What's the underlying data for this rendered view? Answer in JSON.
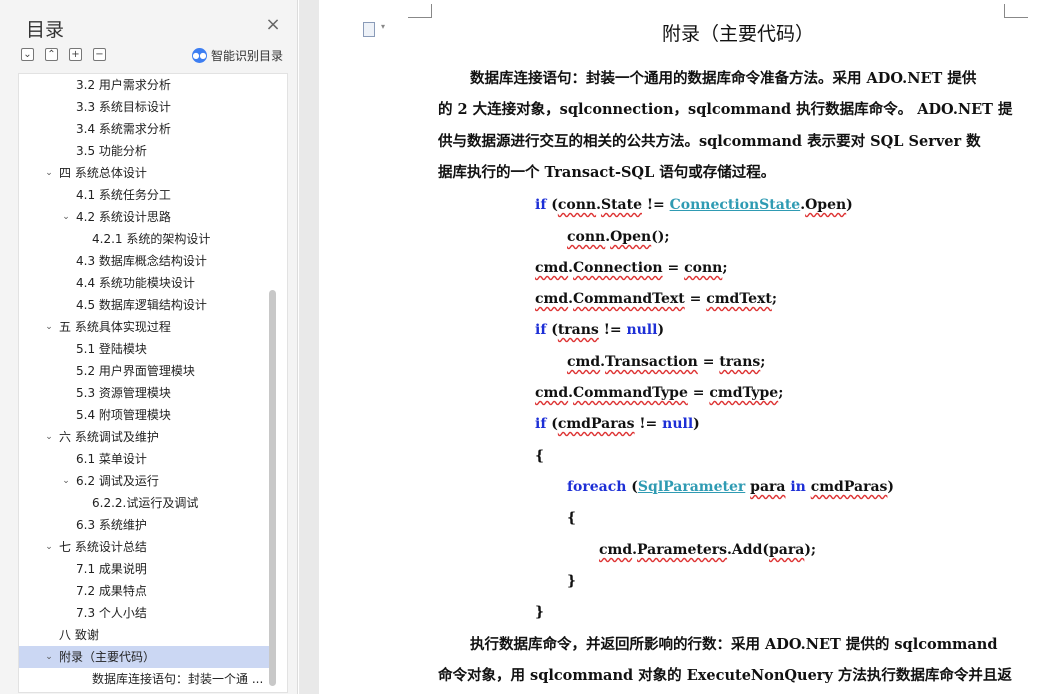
{
  "nav": {
    "title": "目录",
    "close_glyph": "×",
    "toolbar": {
      "collapse_all": "⌄",
      "expand_level": "⌃",
      "add_heading": "+",
      "remove_heading": "−"
    },
    "smart_toc_label": "智能识别目录",
    "items": [
      {
        "label": "3.2 用户需求分析",
        "level": 2
      },
      {
        "label": "3.3 系统目标设计",
        "level": 2
      },
      {
        "label": "3.4 系统需求分析",
        "level": 2
      },
      {
        "label": "3.5 功能分析",
        "level": 2
      },
      {
        "label": "四 系统总体设计",
        "level": 1,
        "expanded": true
      },
      {
        "label": "4.1 系统任务分工",
        "level": 2
      },
      {
        "label": "4.2 系统设计思路",
        "level": 2,
        "expanded": true
      },
      {
        "label": "4.2.1 系统的架构设计",
        "level": 3
      },
      {
        "label": "4.3 数据库概念结构设计",
        "level": 2
      },
      {
        "label": "4.4 系统功能模块设计",
        "level": 2
      },
      {
        "label": "4.5 数据库逻辑结构设计",
        "level": 2
      },
      {
        "label": "五 系统具体实现过程",
        "level": 1,
        "expanded": true
      },
      {
        "label": "5.1 登陆模块",
        "level": 2
      },
      {
        "label": "5.2 用户界面管理模块",
        "level": 2
      },
      {
        "label": "5.3 资源管理模块",
        "level": 2
      },
      {
        "label": "5.4 附项管理模块",
        "level": 2
      },
      {
        "label": "六 系统调试及维护",
        "level": 1,
        "expanded": true
      },
      {
        "label": "6.1 菜单设计",
        "level": 2
      },
      {
        "label": "6.2 调试及运行",
        "level": 2,
        "expanded": true
      },
      {
        "label": "6.2.2.试运行及调试",
        "level": 3
      },
      {
        "label": "6.3 系统维护",
        "level": 2
      },
      {
        "label": "七 系统设计总结",
        "level": 1,
        "expanded": true
      },
      {
        "label": "7.1 成果说明",
        "level": 2
      },
      {
        "label": "7.2 成果特点",
        "level": 2
      },
      {
        "label": "7.3 个人小结",
        "level": 2
      },
      {
        "label": "八 致谢",
        "level": 1
      },
      {
        "label": "附录（主要代码）",
        "level": 1,
        "expanded": true,
        "selected": true
      },
      {
        "label": "数据库连接语句：封装一个通 ...",
        "level": 3
      }
    ]
  },
  "document": {
    "heading": "附录（主要代码）",
    "intro_lines": [
      "数据库连接语句：封装一个通用的数据库命令准备方法。采用 ADO.NET 提供",
      "的 2 大连接对象，sqlconnection，sqlcommand 执行数据库命令。 ADO.NET 提",
      "供与数据源进行交互的相关的公共方法。sqlcommand 表示要对 SQL Server 数",
      "据库执行的一个 Transact-SQL 语句或存储过程。"
    ],
    "code_lines": [
      "if (conn.State != ConnectionState.Open)",
      "conn.Open();",
      "cmd.Connection = conn;",
      "cmd.CommandText = cmdText;",
      "if (trans != null)",
      "cmd.Transaction = trans;",
      "cmd.CommandType = cmdType;",
      "if (cmdParas != null)",
      "{",
      "foreach (SqlParameter para in cmdParas)",
      "{",
      "cmd.Parameters.Add(para);",
      "}",
      "}"
    ],
    "outro_lines": [
      "执行数据库命令，并返回所影响的行数：采用 ADO.NET 提供的 sqlcommand",
      "命令对象，用 sqlcommand 对象的 ExecuteNonQuery 方法执行数据库命令并且返"
    ]
  },
  "colors": {
    "keyword": "#1d2fd6",
    "type": "#2f9bb3",
    "selection": "#cbd7f3"
  }
}
